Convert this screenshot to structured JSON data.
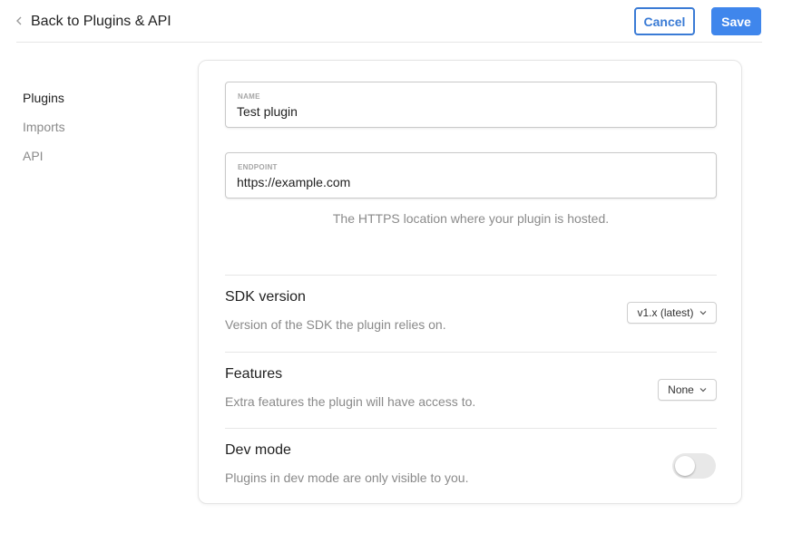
{
  "header": {
    "back_label": "Back to Plugins & API",
    "cancel_label": "Cancel",
    "save_label": "Save"
  },
  "sidebar": {
    "items": [
      {
        "label": "Plugins",
        "active": true
      },
      {
        "label": "Imports",
        "active": false
      },
      {
        "label": "API",
        "active": false
      }
    ]
  },
  "form": {
    "name_label": "NAME",
    "name_value": "Test plugin",
    "endpoint_label": "ENDPOINT",
    "endpoint_value": "https://example.com",
    "endpoint_hint": "The HTTPS location where your plugin is hosted."
  },
  "settings": {
    "sdk": {
      "title": "SDK version",
      "description": "Version of the SDK the plugin relies on.",
      "selected": "v1.x (latest)"
    },
    "features": {
      "title": "Features",
      "description": "Extra features the plugin will have access to.",
      "selected": "None"
    },
    "dev_mode": {
      "title": "Dev mode",
      "description": "Plugins in dev mode are only visible to you.",
      "enabled": false
    }
  },
  "colors": {
    "accent": "#3f86ec",
    "muted_text": "#8a8a8a"
  },
  "icons": {
    "back": "chevron-left-icon",
    "dropdown": "chevron-down-icon"
  }
}
